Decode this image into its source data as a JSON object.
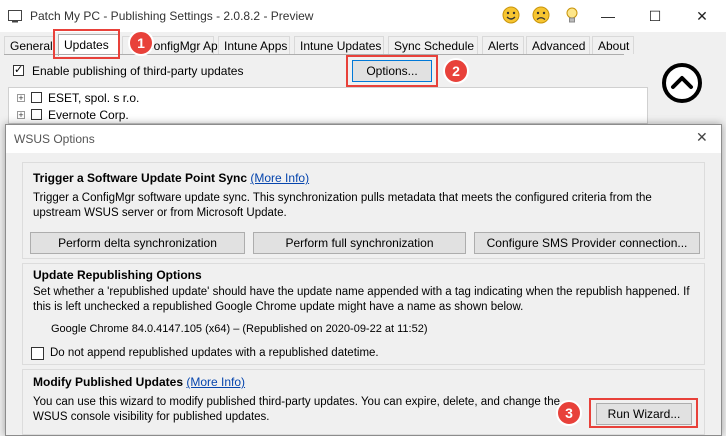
{
  "window": {
    "title": "Patch My PC - Publishing Settings - 2.0.8.2 - Preview",
    "minimize_glyph": "—",
    "maximize_glyph": "☐",
    "close_glyph": "✕"
  },
  "tabs": [
    {
      "label": "General"
    },
    {
      "label": "Updates",
      "active": true
    },
    {
      "label": "ConfigMgr Apps"
    },
    {
      "label": "Intune Apps"
    },
    {
      "label": "Intune Updates"
    },
    {
      "label": "Sync Schedule"
    },
    {
      "label": "Alerts"
    },
    {
      "label": "Advanced"
    },
    {
      "label": "About"
    }
  ],
  "updates": {
    "enable_label": "Enable publishing of third-party updates",
    "enable_checked_glyph": "✓",
    "options_button": "Options...",
    "tree": [
      {
        "label": "ESET, spol. s r.o."
      },
      {
        "label": "Evernote Corp."
      }
    ],
    "expander_glyph": "+"
  },
  "callouts": {
    "one": "1",
    "two": "2",
    "three": "3"
  },
  "dialog": {
    "title": "WSUS Options",
    "close_glyph": "✕",
    "sync": {
      "title": "Trigger a Software Update Point Sync",
      "more_info": "(More Info)",
      "description": "Trigger a ConfigMgr software update sync. This synchronization pulls metadata that meets the configured criteria from the upstream WSUS server or from Microsoft Update.",
      "btn_delta": "Perform delta synchronization",
      "btn_full": "Perform full synchronization",
      "btn_sms": "Configure SMS Provider connection..."
    },
    "republish": {
      "title": "Update Republishing Options",
      "description": "Set whether a 'republished update' should have the update name appended with a tag indicating when the republish happened. If this is left unchecked a republished Google Chrome update might have a name as shown below.",
      "example": "Google Chrome 84.0.4147.105 (x64) – (Republished on 2020-09-22 at 11:52)",
      "checkbox_label": "Do not append republished updates with a republished datetime."
    },
    "modify": {
      "title": "Modify Published Updates",
      "more_info": "(More Info)",
      "description": "You can use this wizard to modify published third-party updates. You can expire, delete, and change the WSUS console visibility for published updates.",
      "btn_wizard": "Run Wizard..."
    }
  },
  "colors": {
    "callout": "#e8413a",
    "link": "#0645ad",
    "focus": "#0078d7"
  }
}
